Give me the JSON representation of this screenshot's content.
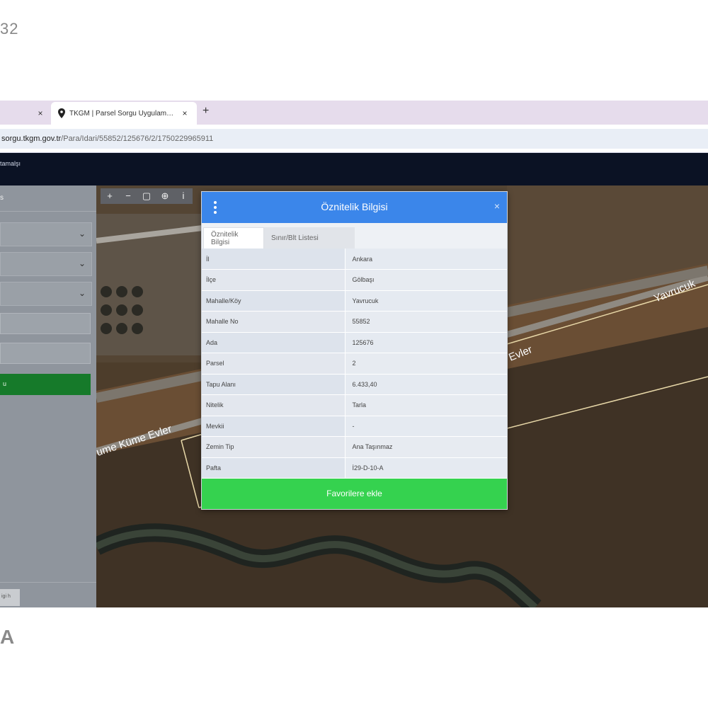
{
  "corner_top_text": "32",
  "corner_bottom_text": "A",
  "browser": {
    "prev_tab_close": "×",
    "active_tab_title": "TKGM | Parsel Sorgu Uygulam…",
    "active_tab_close": "×",
    "new_tab": "+",
    "url_host": "sorgu.tkgm.gov.tr",
    "url_path": "/Para/Idari/55852/125676/2/1750229965911"
  },
  "app": {
    "title_fragment": "tamalşı"
  },
  "sidebar": {
    "heading": "s",
    "select_chevron": "⌄",
    "button_label": "u",
    "footer_badge": "igi h"
  },
  "toolbar": {
    "zoom_in": "+",
    "zoom_out": "−",
    "frame": "▢",
    "locate": "⊕",
    "info": "i"
  },
  "modal": {
    "title": "Öznitelik Bilgisi",
    "close": "×",
    "tabs": [
      "Öznitelik Bilgisi",
      "Sınır/Blt Listesi"
    ],
    "rows": [
      {
        "key": "İl",
        "value": "Ankara"
      },
      {
        "key": "İlçe",
        "value": "Gölbaşı"
      },
      {
        "key": "Mahalle/Köy",
        "value": "Yavrucuk"
      },
      {
        "key": "Mahalle No",
        "value": "55852"
      },
      {
        "key": "Ada",
        "value": "125676"
      },
      {
        "key": "Parsel",
        "value": "2"
      },
      {
        "key": "Tapu Alanı",
        "value": "6.433,40"
      },
      {
        "key": "Nitelik",
        "value": "Tarla"
      },
      {
        "key": "Mevkii",
        "value": "-"
      },
      {
        "key": "Zemin Tip",
        "value": "Ana Taşınmaz"
      },
      {
        "key": "Pafta",
        "value": "İ29-D-10-A"
      }
    ],
    "favorite_button": "Favorilere ekle"
  },
  "map_labels": {
    "road_1": "Yavrucuk",
    "road_2": "Evler",
    "road_3": "ume Küme Evler"
  },
  "colors": {
    "modal_header": "#3b86ea",
    "favorite_button": "#35d24f",
    "sidebar_button": "#167a2a",
    "app_header": "#0b1224"
  }
}
